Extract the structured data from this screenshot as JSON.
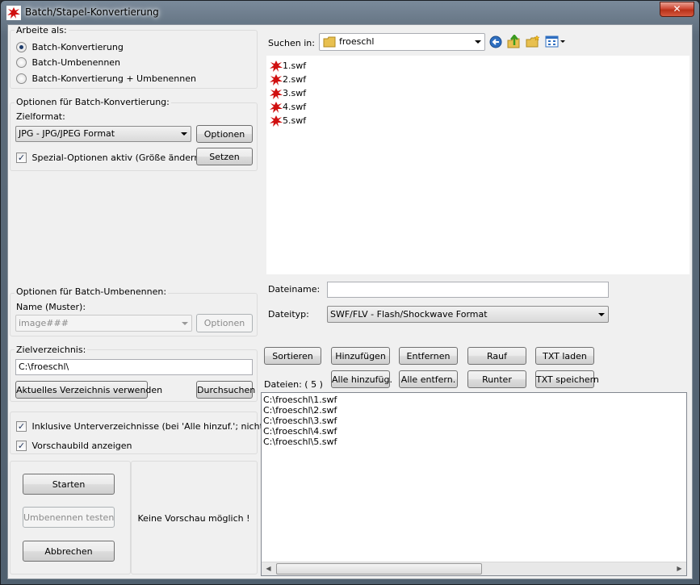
{
  "window": {
    "title": "Batch/Stapel-Konvertierung",
    "close_glyph": "✕"
  },
  "mode": {
    "group_label": "Arbeite als:",
    "options": [
      {
        "label": "Batch-Konvertierung",
        "selected": true
      },
      {
        "label": "Batch-Umbenennen",
        "selected": false
      },
      {
        "label": "Batch-Konvertierung + Umbenennen",
        "selected": false
      }
    ]
  },
  "convert_options": {
    "group_label": "Optionen für Batch-Konvertierung:",
    "format_label": "Zielformat:",
    "format_value": "JPG - JPG/JPEG Format",
    "options_button": "Optionen",
    "special_label": "Spezial-Optionen aktiv (Größe ändern etc.)",
    "special_checked": true,
    "set_button": "Setzen"
  },
  "rename_options": {
    "group_label": "Optionen für Batch-Umbenennen:",
    "pattern_label": "Name (Muster):",
    "pattern_value": "image###",
    "options_button": "Optionen"
  },
  "target_dir": {
    "group_label": "Zielverzeichnis:",
    "value": "C:\\froeschl\\",
    "use_current_button": "Aktuelles Verzeichnis verwenden",
    "browse_button": "Durchsuchen"
  },
  "checkboxes": {
    "include_subdirs": "Inklusive Unterverzeichnisse (bei 'Alle hinzuf.'; nicht gesp.)",
    "include_subdirs_checked": true,
    "show_preview": "Vorschaubild anzeigen",
    "show_preview_checked": true
  },
  "actions": {
    "start": "Starten",
    "test_rename": "Umbenennen testen",
    "cancel": "Abbrechen"
  },
  "preview": {
    "text": "Keine Vorschau möglich !"
  },
  "browser": {
    "look_in_label": "Suchen in:",
    "look_in_value": "froeschl",
    "files": [
      "1.swf",
      "2.swf",
      "3.swf",
      "4.swf",
      "5.swf"
    ],
    "filename_label": "Dateiname:",
    "filename_value": "",
    "filetype_label": "Dateityp:",
    "filetype_value": "SWF/FLV - Flash/Shockwave Format"
  },
  "list_buttons": {
    "sort": "Sortieren",
    "add": "Hinzufügen",
    "remove": "Entfernen",
    "up": "Rauf",
    "load_txt": "TXT laden",
    "add_all": "Alle hinzufüg.",
    "remove_all": "Alle entfern.",
    "down": "Runter",
    "save_txt": "TXT speichern"
  },
  "file_list": {
    "label": "Dateien:  ( 5 )",
    "items": [
      "C:\\froeschl\\1.swf",
      "C:\\froeschl\\2.swf",
      "C:\\froeschl\\3.swf",
      "C:\\froeschl\\4.swf",
      "C:\\froeschl\\5.swf"
    ]
  },
  "colors": {
    "accent_red": "#d01010",
    "folder_yellow": "#e8c050",
    "nav_blue": "#2f6fc0"
  }
}
